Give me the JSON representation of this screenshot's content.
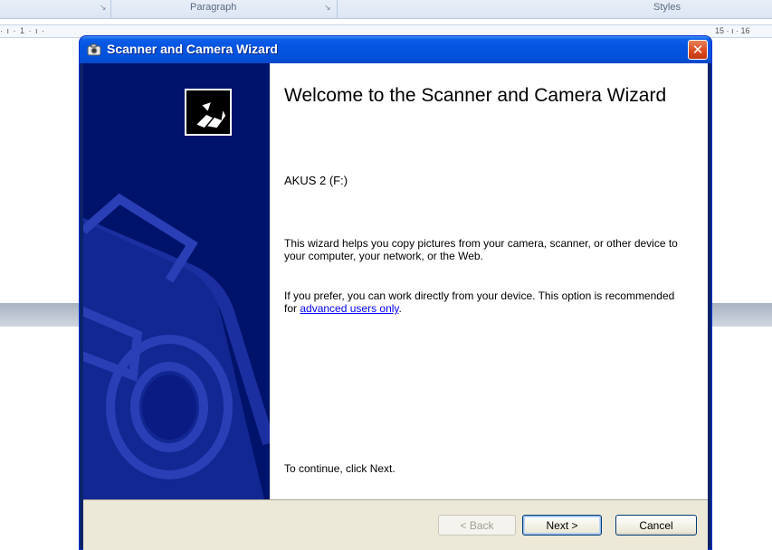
{
  "background_app": {
    "ribbon_groups": [
      "Paragraph",
      "Styles"
    ],
    "ruler_left": "· ı · 1 · ı ·",
    "ruler_right": "15 · ı · 16"
  },
  "dialog": {
    "title": "Scanner and Camera Wizard",
    "close_label": "✕",
    "heading": "Welcome to the Scanner and Camera Wizard",
    "device_name": "AKUS 2 (F:)",
    "paragraph1": "This wizard helps you copy pictures from your camera, scanner, or other device to your computer, your network, or the Web.",
    "paragraph2_prefix": "If you prefer, you can work directly from your device. This option is recommended for ",
    "paragraph2_link": "advanced users only",
    "paragraph2_suffix": ".",
    "continue_text": "To continue, click Next.",
    "buttons": {
      "back": "< Back",
      "next": "Next >",
      "cancel": "Cancel"
    }
  },
  "colors": {
    "titlebar": "#0454e2",
    "sidebar": "#00136b",
    "button_face": "#ece9d8",
    "close_button": "#d9481c",
    "link": "#0000ee"
  }
}
